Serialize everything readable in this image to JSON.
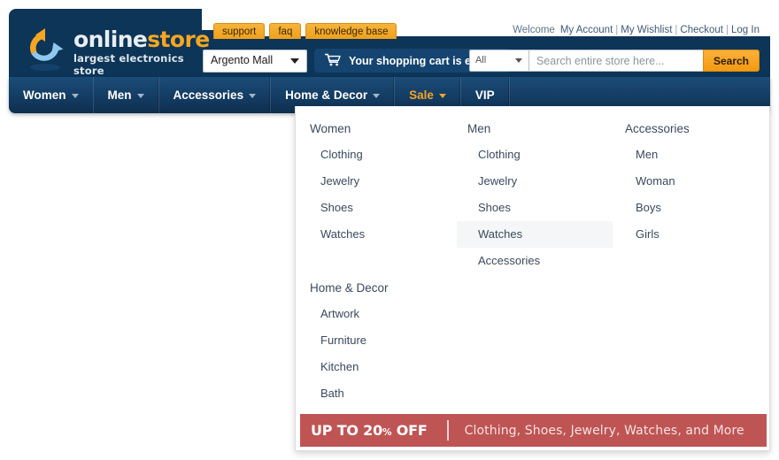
{
  "header": {
    "tabs": [
      {
        "label": "support"
      },
      {
        "label": "faq"
      },
      {
        "label": "knowledge base"
      }
    ],
    "account": {
      "welcome": "Welcome",
      "my_account": "My Account",
      "my_wishlist": "My Wishlist",
      "checkout": "Checkout",
      "log_in": "Log In",
      "separator": "|"
    },
    "logo": {
      "word1": "online",
      "word2": "store",
      "tagline": "largest electronics store",
      "mark_icon": "circular-arrows-icon",
      "color_word1": "#e9eef2",
      "color_word2": "#f5a623"
    },
    "store_switcher": {
      "value": "Argento Mall",
      "caret_icon": "chevron-down-icon"
    },
    "cart": {
      "icon": "shopping-cart-icon",
      "label": "Your shopping cart is empty"
    },
    "search": {
      "category_value": "All",
      "category_caret_icon": "chevron-down-icon",
      "placeholder": "Search entire store here...",
      "value": "",
      "button_label": "Search"
    },
    "background_color": "#0c3557"
  },
  "nav": {
    "items": [
      {
        "label": "Women",
        "has_caret": true,
        "highlight": false
      },
      {
        "label": "Men",
        "has_caret": true,
        "highlight": false
      },
      {
        "label": "Accessories",
        "has_caret": true,
        "highlight": false
      },
      {
        "label": "Home & Decor",
        "has_caret": true,
        "highlight": false
      },
      {
        "label": "Sale",
        "has_caret": true,
        "highlight": true
      },
      {
        "label": "VIP",
        "has_caret": false,
        "highlight": false
      }
    ],
    "sale_color": "#f2a426"
  },
  "mega_menu": {
    "columns": [
      {
        "title": "Women",
        "items": [
          {
            "label": "Clothing",
            "active": false
          },
          {
            "label": "Jewelry",
            "active": false
          },
          {
            "label": "Shoes",
            "active": false
          },
          {
            "label": "Watches",
            "active": false
          }
        ]
      },
      {
        "title": "Men",
        "items": [
          {
            "label": "Clothing",
            "active": false
          },
          {
            "label": "Jewelry",
            "active": false
          },
          {
            "label": "Shoes",
            "active": false
          },
          {
            "label": "Watches",
            "active": true
          },
          {
            "label": "Accessories",
            "active": false
          }
        ]
      },
      {
        "title": "Accessories",
        "items": [
          {
            "label": "Men",
            "active": false
          },
          {
            "label": "Woman",
            "active": false
          },
          {
            "label": "Boys",
            "active": false
          },
          {
            "label": "Girls",
            "active": false
          }
        ]
      },
      {
        "title": "Home & Decor",
        "items": [
          {
            "label": "Artwork",
            "active": false
          },
          {
            "label": "Furniture",
            "active": false
          },
          {
            "label": "Kitchen",
            "active": false
          },
          {
            "label": "Bath",
            "active": false
          }
        ]
      }
    ],
    "promo": {
      "headline_prefix": "UP TO 20",
      "headline_pct": "%",
      "headline_suffix": " OFF",
      "subtext": "Clothing, Shoes, Jewelry, Watches, and More",
      "background_color": "#bf5454"
    },
    "highlight_color": "#f4f6f7"
  }
}
